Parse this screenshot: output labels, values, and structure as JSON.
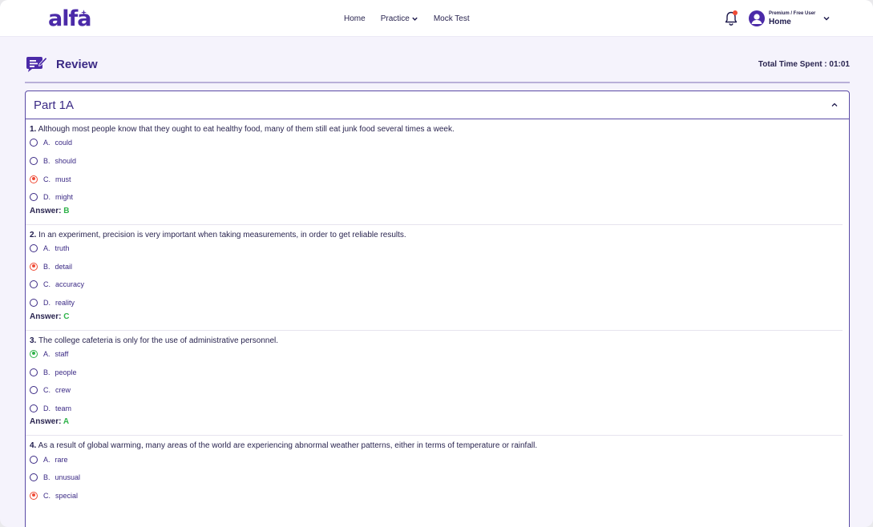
{
  "header": {
    "logo_text": "alfa",
    "nav": [
      {
        "label": "Home",
        "has_dropdown": false
      },
      {
        "label": "Practice",
        "has_dropdown": true
      },
      {
        "label": "Mock Test",
        "has_dropdown": false
      }
    ],
    "user": {
      "subtitle": "Premium / Free User",
      "name": "Home"
    },
    "notification_icon": "bell-icon",
    "colors": {
      "brand": "#4b2aa8",
      "notification_dot": "#ef4b36"
    }
  },
  "page": {
    "title": "Review",
    "time_spent_label": "Total Time Spent : 01:01"
  },
  "section": {
    "title": "Part 1A",
    "expanded": true,
    "questions": [
      {
        "number": "1.",
        "text": "Although most people know that they ought to eat healthy food, many of them still eat junk food several times a week.",
        "options": [
          {
            "letter": "A.",
            "text": "could",
            "state": "none"
          },
          {
            "letter": "B.",
            "text": "should",
            "state": "none"
          },
          {
            "letter": "C.",
            "text": "must",
            "state": "wrong"
          },
          {
            "letter": "D.",
            "text": "might",
            "state": "none"
          }
        ],
        "answer_label": "Answer:",
        "answer_value": "B"
      },
      {
        "number": "2.",
        "text": "In an experiment, precision is very important when taking measurements, in order to get reliable results.",
        "options": [
          {
            "letter": "A.",
            "text": "truth",
            "state": "none"
          },
          {
            "letter": "B.",
            "text": "detail",
            "state": "wrong"
          },
          {
            "letter": "C.",
            "text": "accuracy",
            "state": "none"
          },
          {
            "letter": "D.",
            "text": "reality",
            "state": "none"
          }
        ],
        "answer_label": "Answer:",
        "answer_value": "C"
      },
      {
        "number": "3.",
        "text": "The college cafeteria is only for the use of administrative personnel.",
        "options": [
          {
            "letter": "A.",
            "text": "staff",
            "state": "correct"
          },
          {
            "letter": "B.",
            "text": "people",
            "state": "none"
          },
          {
            "letter": "C.",
            "text": "crew",
            "state": "none"
          },
          {
            "letter": "D.",
            "text": "team",
            "state": "none"
          }
        ],
        "answer_label": "Answer:",
        "answer_value": "A"
      },
      {
        "number": "4.",
        "text": "As a result of global warming, many areas of the world are experiencing abnormal weather patterns, either in terms of temperature or rainfall.",
        "options": [
          {
            "letter": "A.",
            "text": "rare",
            "state": "none"
          },
          {
            "letter": "B.",
            "text": "unusual",
            "state": "none"
          },
          {
            "letter": "C.",
            "text": "special",
            "state": "wrong"
          }
        ]
      }
    ]
  },
  "state_colors": {
    "wrong": "#ef4b36",
    "correct": "#2fb34a"
  }
}
